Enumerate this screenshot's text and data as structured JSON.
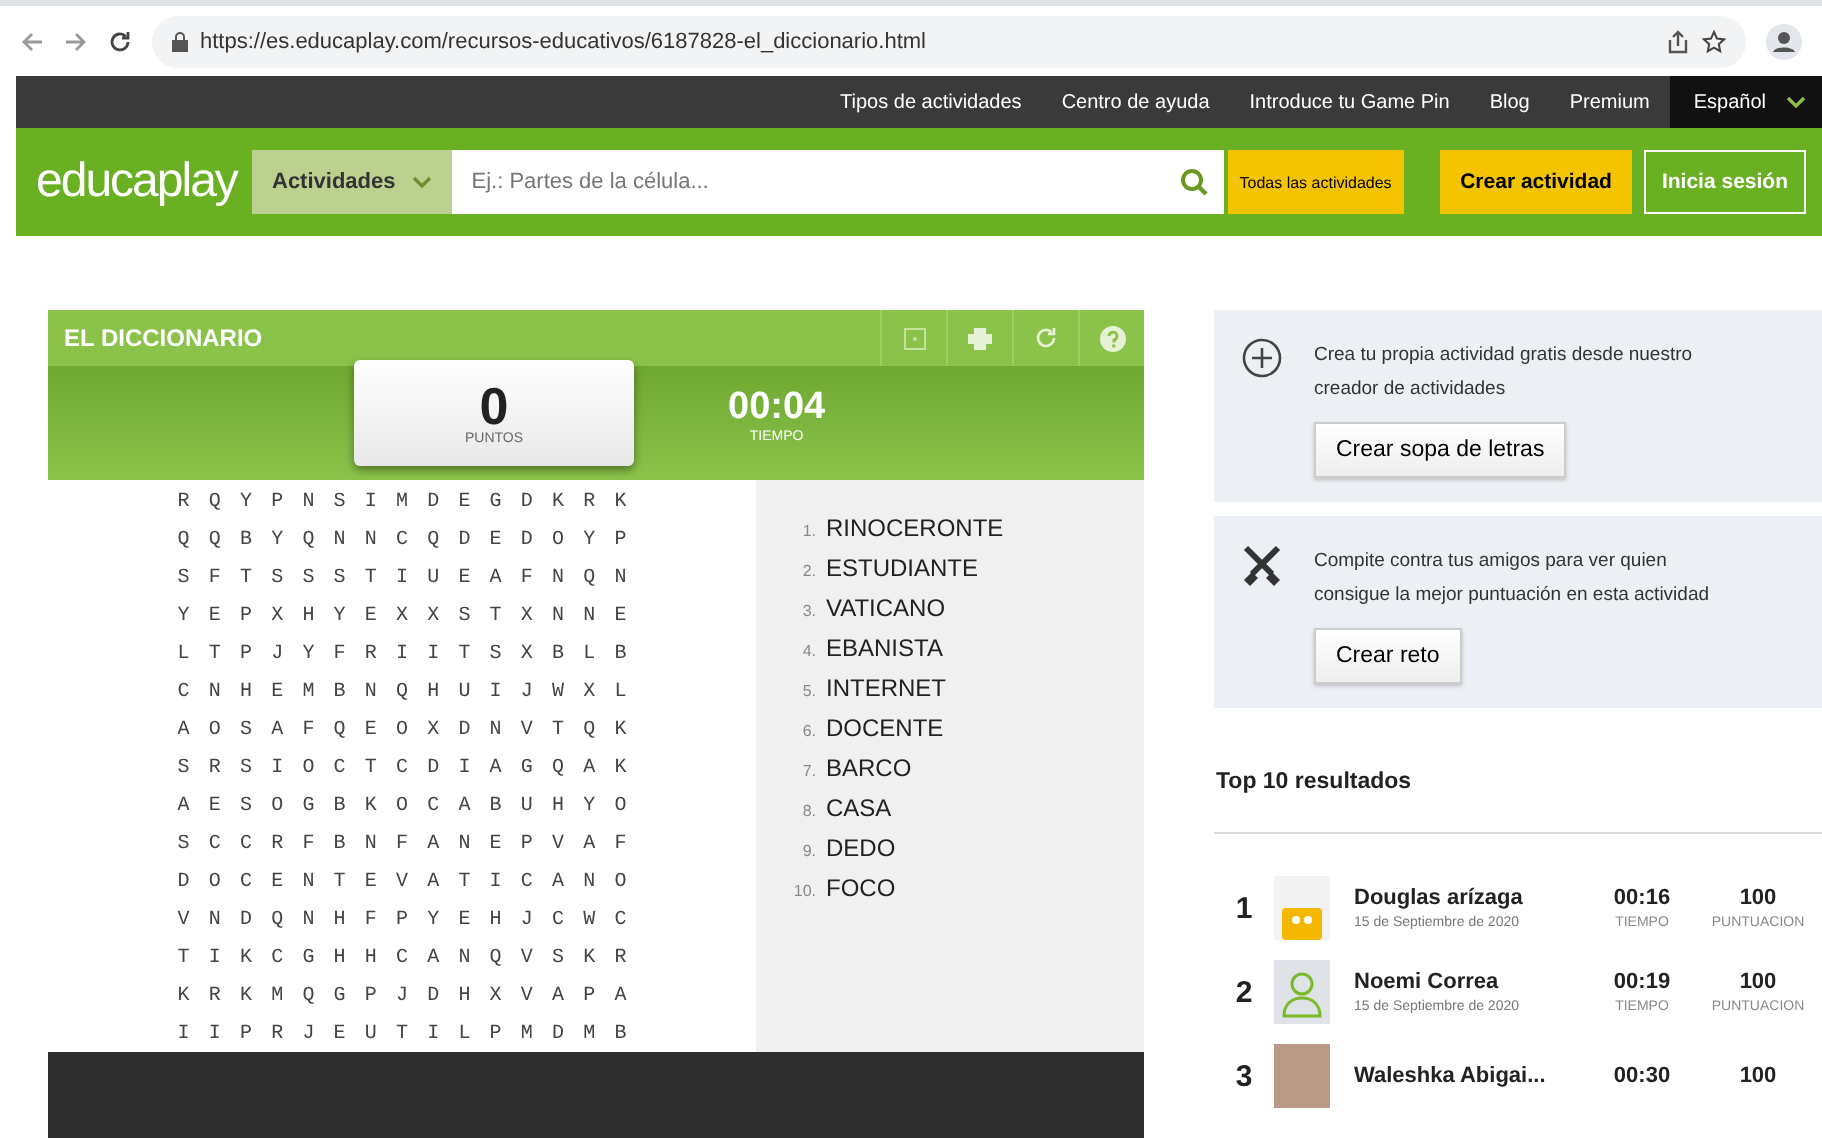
{
  "browser": {
    "url": "https://es.educaplay.com/recursos-educativos/6187828-el_diccionario.html"
  },
  "top_nav": {
    "links": [
      "Tipos de actividades",
      "Centro de ayuda",
      "Introduce tu Game Pin",
      "Blog",
      "Premium"
    ],
    "language": "Español"
  },
  "header": {
    "logo": "educaplay",
    "category": "Actividades",
    "search_placeholder": "Ej.: Partes de la célula...",
    "all_button": "Todas las actividades",
    "create_button": "Crear actividad",
    "login_button": "Inicia sesión"
  },
  "game": {
    "title": "EL DICCIONARIO",
    "score": "0",
    "score_label": "PUNTOS",
    "time": "00:04",
    "time_label": "TIEMPO",
    "grid": [
      "R Q Y P N S I M D E G D K R K",
      "Q Q B Y Q N N C Q D E D O Y P",
      "S F T S S S T I U E A F N Q N",
      "Y E P X H Y E X X S T X N N E",
      "L T P J Y F R I I T S X B L B",
      "C N H E M B N Q H U I J W X L",
      "A O S A F Q E O X D N V T Q K",
      "S R S I O C T C D I A G Q A K",
      "A E S O G B K O C A B U H Y O",
      "S C C R F B N F A N E P V A F",
      "D O C E N T E V A T I C A N O",
      "V N D Q N H F P Y E H J C W C",
      "T I K C G H H C A N Q V S K R",
      "K R K M Q G P J D H X V A P A",
      "I I P R J E U T I L P M D M B"
    ],
    "words": [
      {
        "number": "1.",
        "word": "RINOCERONTE"
      },
      {
        "number": "2.",
        "word": "ESTUDIANTE"
      },
      {
        "number": "3.",
        "word": "VATICANO"
      },
      {
        "number": "4.",
        "word": "EBANISTA"
      },
      {
        "number": "5.",
        "word": "INTERNET"
      },
      {
        "number": "6.",
        "word": "DOCENTE"
      },
      {
        "number": "7.",
        "word": "BARCO"
      },
      {
        "number": "8.",
        "word": "CASA"
      },
      {
        "number": "9.",
        "word": "DEDO"
      },
      {
        "number": "10.",
        "word": "FOCO"
      }
    ]
  },
  "promos": [
    {
      "kind": "create",
      "text": "Crea tu propia actividad gratis desde nuestro creador de actividades",
      "button": "Crear sopa de letras"
    },
    {
      "kind": "challenge",
      "text": "Compite contra tus amigos para ver quien consigue la mejor puntuación en esta actividad",
      "button": "Crear reto"
    }
  ],
  "leaderboard": {
    "title": "Top 10 resultados",
    "rows": [
      {
        "rank": "1",
        "kind": "cartoon",
        "name": "Douglas arízaga",
        "date": "15 de Septiembre de 2020",
        "time": "00:16",
        "time_label": "TIEMPO",
        "score": "100",
        "score_label": "PUNTUACION"
      },
      {
        "rank": "2",
        "kind": "default",
        "name": "Noemi Correa",
        "date": "15 de Septiembre de 2020",
        "time": "00:19",
        "time_label": "TIEMPO",
        "score": "100",
        "score_label": "PUNTUACION"
      },
      {
        "rank": "3",
        "kind": "photo",
        "name": "Waleshka Abigai...",
        "time": "00:30",
        "score": "100"
      }
    ]
  }
}
